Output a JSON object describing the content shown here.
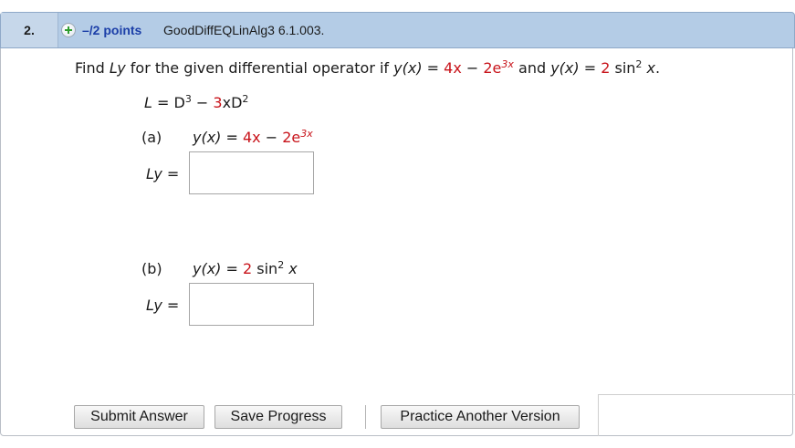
{
  "header": {
    "question_number": "2.",
    "points": "–/2 points",
    "question_id": "GoodDiffEQLinAlg3 6.1.003."
  },
  "prompt": {
    "p1": "Find ",
    "ly": "Ly",
    "p2": " for the given differential operator if ",
    "yx": "y(x)",
    "eq": " = ",
    "a1": "4x",
    "minus": " − ",
    "a2": "2e",
    "a2exp": "3x",
    "and": " and ",
    "yx2": "y(x)",
    "eq2": " = ",
    "b1": "2",
    "b2": " sin",
    "b2exp": "2",
    "b3": " x",
    "period": "."
  },
  "operator": {
    "L": "L",
    "eq": " = D",
    "d3": "3",
    "minus": " − ",
    "coef": "3",
    "xd": "xD",
    "d2": "2"
  },
  "part_a": {
    "label": "(a)",
    "yx": "y(x)",
    "eq": " = ",
    "v1": "4x",
    "minus": " − ",
    "v2": "2e",
    "v2exp": "3x",
    "ly_label": "Ly",
    "ly_eq": " =",
    "answer_value": ""
  },
  "part_b": {
    "label": "(b)",
    "yx": "y(x)",
    "eq": " = ",
    "v1": "2",
    "sin": " sin",
    "sinexp": "2",
    "x": " x",
    "ly_label": "Ly",
    "ly_eq": " =",
    "answer_value": ""
  },
  "buttons": {
    "submit": "Submit Answer",
    "save": "Save Progress",
    "practice": "Practice Another Version"
  },
  "colors": {
    "header_bg": "#b4cce6",
    "points_blue": "#1c3fa8",
    "value_red": "#c8131a"
  }
}
